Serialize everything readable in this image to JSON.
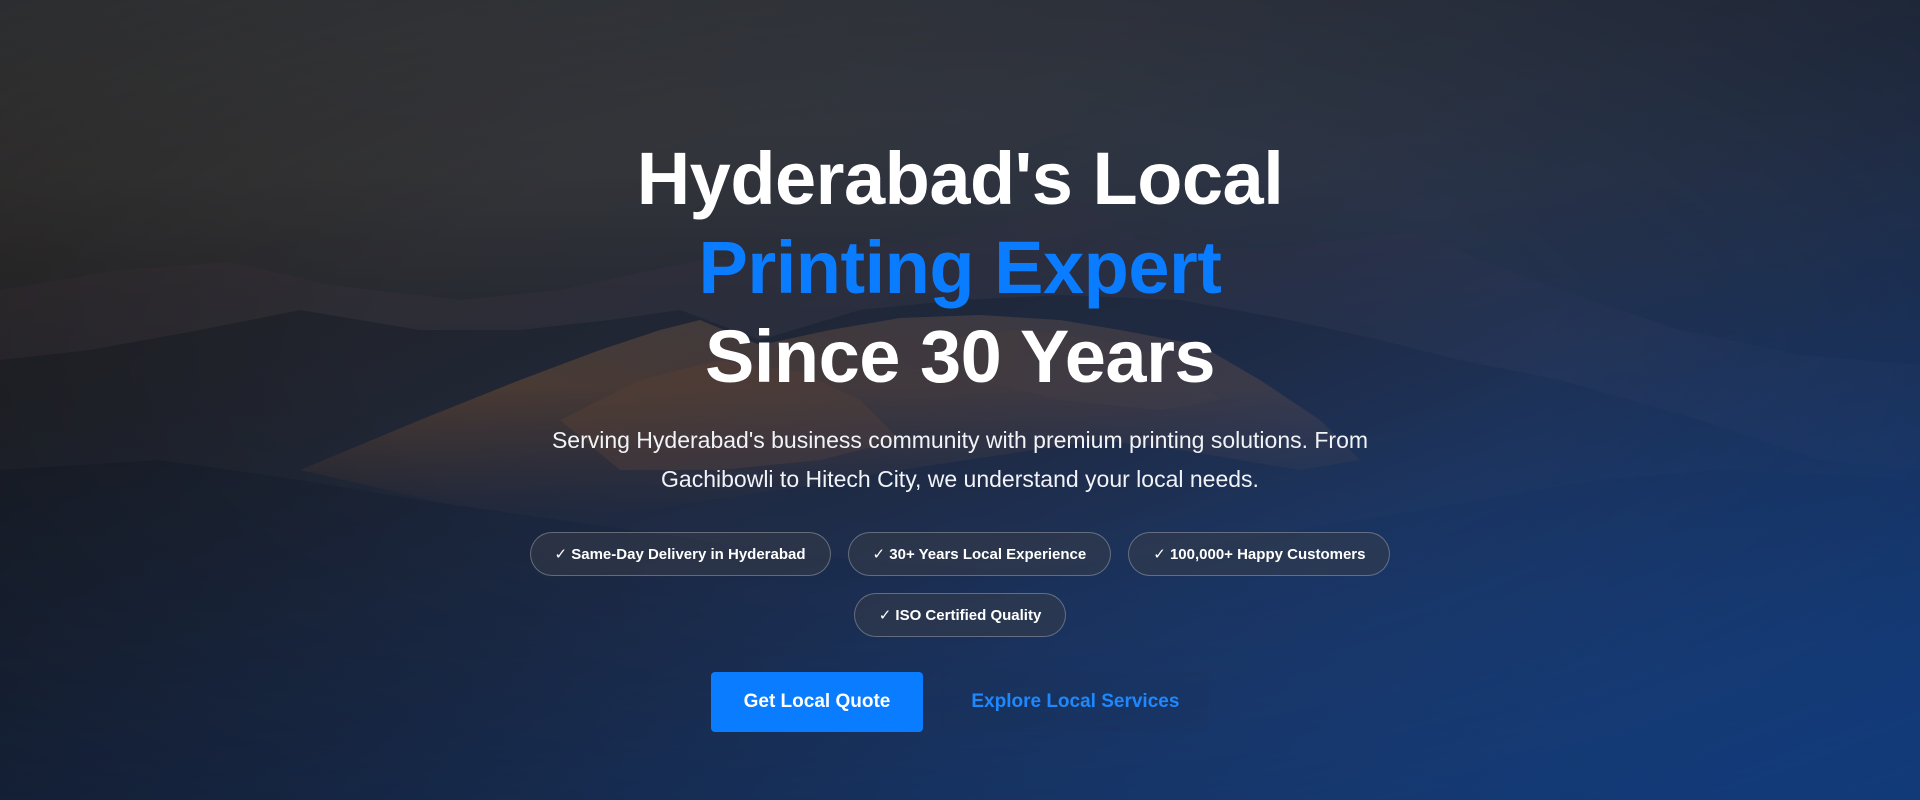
{
  "hero": {
    "headline_line1": "Hyderabad's Local",
    "headline_line2": "Printing Expert",
    "headline_line3": "Since 30 Years",
    "subtitle": "Serving Hyderabad's business community with premium printing solutions. From Gachibowli to Hitech City, we understand your local needs.",
    "badges": [
      "✓ Same-Day Delivery in Hyderabad",
      "✓ 30+ Years Local Experience",
      "✓ 100,000+ Happy Customers",
      "✓ ISO Certified Quality"
    ],
    "primary_button": "Get Local Quote",
    "secondary_button": "Explore Local Services"
  },
  "colors": {
    "accent": "#0a7cff",
    "text": "#ffffff",
    "overlay_top": "#3a3c40",
    "overlay_bottom": "#1a6fe0"
  },
  "background": {
    "description_icon": "mountain-landscape-image"
  }
}
